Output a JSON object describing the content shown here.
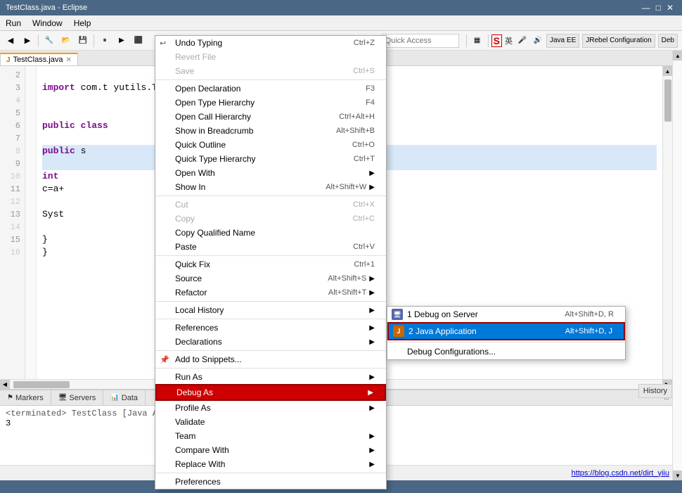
{
  "window": {
    "title": "TestClass.java - Eclipse",
    "min_btn": "—",
    "max_btn": "□",
    "close_btn": "✕"
  },
  "menu_bar": {
    "items": [
      "Run",
      "Window",
      "Help"
    ]
  },
  "toolbar": {
    "buttons": [
      "◀",
      "▶",
      "⏹",
      "🔄",
      "📂",
      "💾",
      "🖨"
    ],
    "quick_access_placeholder": "Quick Access",
    "perspective_java_ee": "Java EE",
    "perspective_jrebel": "JRebel Configuration",
    "perspective_deb": "Deb"
  },
  "editor": {
    "tab_name": "TestClass.java",
    "lines": [
      "",
      "2",
      "3",
      "",
      "5",
      "6",
      "7",
      "",
      "8",
      "9",
      "10",
      "11",
      "",
      "12",
      "13",
      "",
      "14",
      "15",
      "16"
    ],
    "code_lines": [
      "",
      "",
      "import com.t",
      "",
      "",
      "public class",
      "",
      "",
      "   public s",
      "",
      "      int",
      "      c=a+",
      "",
      "",
      "      Syst",
      "",
      "",
      "   }",
      "}"
    ],
    "partial_code": "yutils.TenpayUtil;"
  },
  "context_menu": {
    "items": [
      {
        "label": "Undo Typing",
        "shortcut": "Ctrl+Z",
        "disabled": false,
        "has_icon": true,
        "icon": "↩"
      },
      {
        "label": "Revert File",
        "shortcut": "",
        "disabled": true
      },
      {
        "label": "Save",
        "shortcut": "Ctrl+S",
        "disabled": true
      },
      {
        "separator_before": true
      },
      {
        "label": "Open Declaration",
        "shortcut": "F3"
      },
      {
        "label": "Open Type Hierarchy",
        "shortcut": "F4"
      },
      {
        "label": "Open Call Hierarchy",
        "shortcut": "Ctrl+Alt+H"
      },
      {
        "label": "Show in Breadcrumb",
        "shortcut": "Alt+Shift+B"
      },
      {
        "label": "Quick Outline",
        "shortcut": "Ctrl+O"
      },
      {
        "label": "Quick Type Hierarchy",
        "shortcut": "Ctrl+T"
      },
      {
        "label": "Open With",
        "arrow": true
      },
      {
        "label": "Show In",
        "shortcut": "Alt+Shift+W",
        "arrow": true
      },
      {
        "separator_before": true
      },
      {
        "label": "Cut",
        "shortcut": "Ctrl+X"
      },
      {
        "label": "Copy",
        "shortcut": "Ctrl+C"
      },
      {
        "label": "Copy Qualified Name"
      },
      {
        "label": "Paste",
        "shortcut": "Ctrl+V"
      },
      {
        "separator_before": true
      },
      {
        "label": "Quick Fix",
        "shortcut": "Ctrl+1"
      },
      {
        "label": "Source",
        "shortcut": "Alt+Shift+S",
        "arrow": true
      },
      {
        "label": "Refactor",
        "shortcut": "Alt+Shift+T",
        "arrow": true
      },
      {
        "separator_before": true
      },
      {
        "label": "Local History",
        "arrow": true
      },
      {
        "separator_before": true
      },
      {
        "label": "References",
        "arrow": true
      },
      {
        "label": "Declarations",
        "arrow": true
      },
      {
        "separator_before": true
      },
      {
        "label": "Add to Snippets...",
        "has_icon": true,
        "icon": "📌"
      },
      {
        "separator_before": true
      },
      {
        "label": "Run As",
        "arrow": true
      },
      {
        "label": "Debug As",
        "arrow": true,
        "highlighted": true
      },
      {
        "label": "Profile As",
        "arrow": true
      },
      {
        "label": "Validate"
      },
      {
        "label": "Team",
        "arrow": true
      },
      {
        "label": "Compare With",
        "arrow": true
      },
      {
        "label": "Replace With",
        "arrow": true
      },
      {
        "separator_before": true
      },
      {
        "label": "Preferences"
      }
    ]
  },
  "submenu": {
    "items": [
      {
        "label": "1 Debug on Server",
        "shortcut": "Alt+Shift+D, R",
        "icon": "🖥",
        "icon_color": "#5566aa"
      },
      {
        "label": "2 Java Application",
        "shortcut": "Alt+Shift+D, J",
        "icon": "J",
        "icon_color": "#cc6600",
        "selected": true
      },
      {
        "separator_before": true
      },
      {
        "label": "Debug Configurations..."
      }
    ]
  },
  "bottom_panel": {
    "tabs": [
      {
        "label": "Markers",
        "icon": "⚑"
      },
      {
        "label": "Servers",
        "icon": "🖥"
      },
      {
        "label": "Data",
        "icon": "📊"
      }
    ],
    "console_text": "<terminated> TestClass [Java Appl",
    "console_line": "3"
  },
  "history": {
    "label": "History"
  },
  "status_bar": {
    "url": "https://blog.csdn.net/dirt_yiiu"
  }
}
